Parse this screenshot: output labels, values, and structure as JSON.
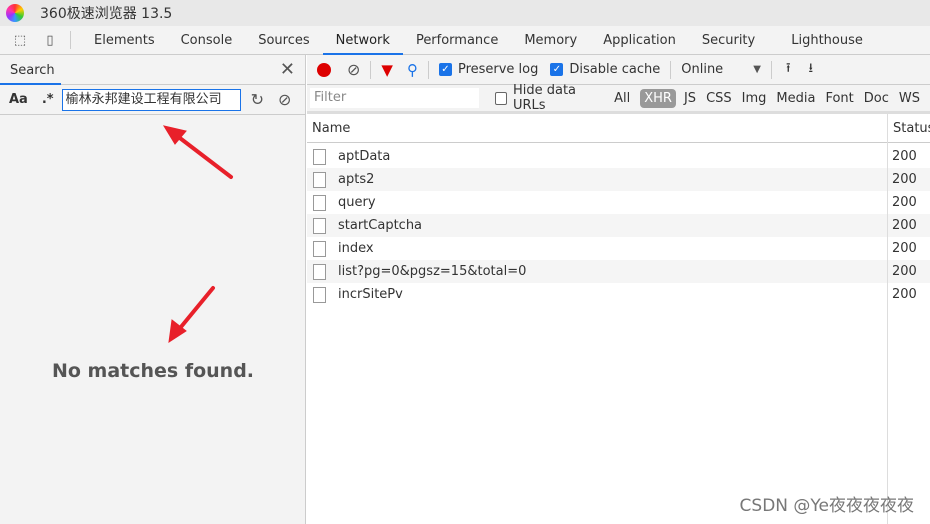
{
  "window": {
    "title": "360极速浏览器 13.5"
  },
  "devtools_tabs": [
    "Elements",
    "Console",
    "Sources",
    "Network",
    "Performance",
    "Memory",
    "Application",
    "Security",
    "Lighthouse"
  ],
  "active_tab": "Network",
  "search_panel": {
    "tab_label": "Search",
    "case_label": "Aa",
    "regex_label": ".*",
    "query": "榆林永邦建设工程有限公司",
    "result": "No matches found."
  },
  "toolbar": {
    "preserve_log": "Preserve log",
    "preserve_checked": true,
    "disable_cache": "Disable cache",
    "disable_checked": true,
    "throttle": "Online"
  },
  "filter": {
    "placeholder": "Filter",
    "hide_data_urls": "Hide data URLs",
    "types": [
      "All",
      "XHR",
      "JS",
      "CSS",
      "Img",
      "Media",
      "Font",
      "Doc",
      "WS"
    ],
    "selected": "XHR"
  },
  "table": {
    "col_name": "Name",
    "col_status": "Status",
    "rows": [
      {
        "name": "aptData",
        "status": "200"
      },
      {
        "name": "apts2",
        "status": "200"
      },
      {
        "name": "query",
        "status": "200"
      },
      {
        "name": "startCaptcha",
        "status": "200"
      },
      {
        "name": "index",
        "status": "200"
      },
      {
        "name": "list?pg=0&pgsz=15&total=0",
        "status": "200"
      },
      {
        "name": "incrSitePv",
        "status": "200"
      }
    ]
  },
  "watermark": "CSDN @Ye夜夜夜夜夜",
  "colors": {
    "accent": "#1a73e8",
    "record": "#dd0000",
    "annotation_arrow": "#e8202a"
  }
}
